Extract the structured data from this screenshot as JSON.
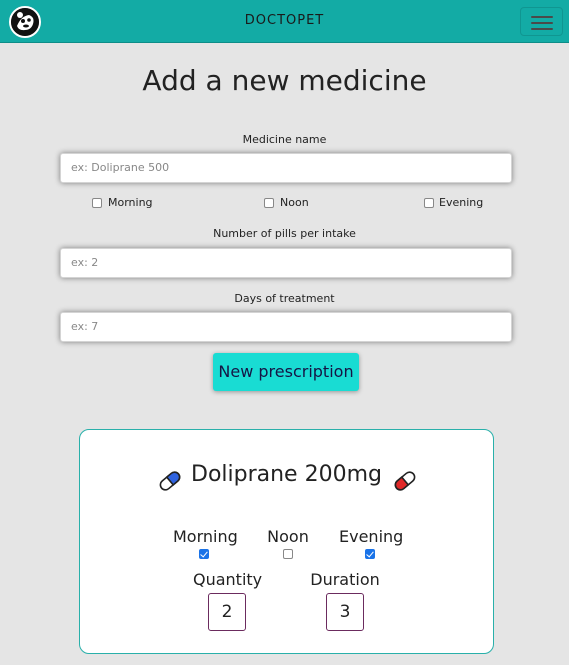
{
  "navbar": {
    "brand": "DOCTOPET",
    "logo_icon": "panda-logo-icon",
    "menu_icon": "hamburger-menu-icon",
    "color": "#13aba5"
  },
  "form": {
    "title": "Add a new medicine",
    "medicine_name": {
      "label": "Medicine name",
      "placeholder": "ex: Doliprane 500",
      "value": ""
    },
    "times": [
      {
        "label": "Morning",
        "checked": false
      },
      {
        "label": "Noon",
        "checked": false
      },
      {
        "label": "Evening",
        "checked": false
      }
    ],
    "pills_per_intake": {
      "label": "Number of pills per intake",
      "placeholder": "ex: 2",
      "value": ""
    },
    "days_of_treatment": {
      "label": "Days of treatment",
      "placeholder": "ex: 7",
      "value": ""
    },
    "submit_label": "New prescription",
    "submit_color": "#19dcd3"
  },
  "prescription_card": {
    "medicine": "Doliprane 200mg",
    "left_icon": "blue-pill-icon",
    "right_icon": "red-pill-icon",
    "schedule": [
      {
        "label": "Morning",
        "checked": true
      },
      {
        "label": "Noon",
        "checked": false
      },
      {
        "label": "Evening",
        "checked": true
      }
    ],
    "quantity": {
      "label": "Quantity",
      "value": "2"
    },
    "duration": {
      "label": "Duration",
      "value": "3"
    },
    "border_color": "#29b0aa"
  }
}
